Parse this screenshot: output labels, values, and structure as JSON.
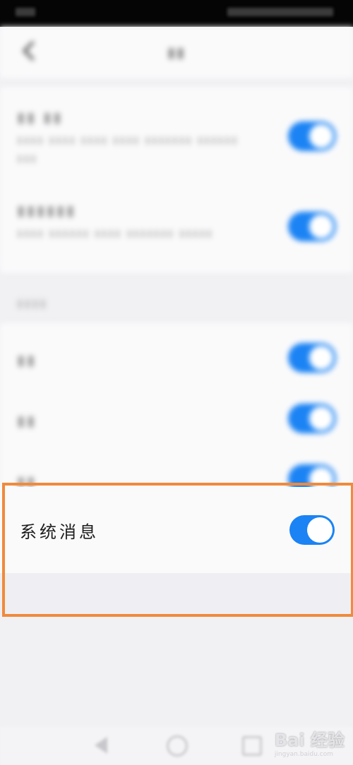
{
  "highlighted_setting": {
    "label": "系统消息",
    "enabled": true
  },
  "blurred_rows": [
    {
      "enabled": true
    },
    {
      "enabled": true
    },
    {
      "enabled": true
    },
    {
      "enabled": true
    },
    {
      "enabled": true
    }
  ],
  "watermark": {
    "brand": "Bai 经验",
    "url": "jingyan.baidu.com"
  },
  "colors": {
    "toggle_on": "#1b83f4",
    "highlight_frame": "#f08a3c"
  },
  "icons": [
    "back-icon",
    "nav-back-icon",
    "nav-home-icon",
    "nav-recent-icon"
  ]
}
